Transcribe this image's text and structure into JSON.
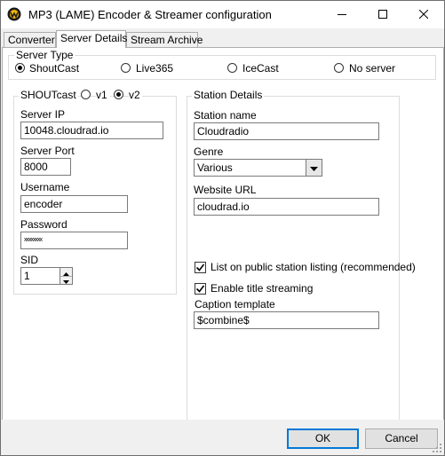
{
  "window": {
    "title": "MP3 (LAME) Encoder & Streamer configuration",
    "app_icon": "winamp-icon",
    "controls": [
      "minimize-icon",
      "maximize-icon",
      "close-icon"
    ]
  },
  "tabs": [
    {
      "label": "Converter",
      "active": false
    },
    {
      "label": "Server Details",
      "active": true
    },
    {
      "label": "Stream Archive",
      "active": false
    }
  ],
  "server_type": {
    "label": "Server Type",
    "options": [
      {
        "label": "ShoutCast",
        "selected": true
      },
      {
        "label": "Live365",
        "selected": false
      },
      {
        "label": "IceCast",
        "selected": false
      },
      {
        "label": "No server",
        "selected": false
      }
    ]
  },
  "shoutcast": {
    "label": "SHOUTcast",
    "version_options": [
      {
        "label": "v1",
        "selected": false
      },
      {
        "label": "v2",
        "selected": true
      }
    ],
    "server_ip_label": "Server IP",
    "server_ip_value": "10048.cloudrad.io",
    "server_port_label": "Server Port",
    "server_port_value": "8000",
    "username_label": "Username",
    "username_value": "encoder",
    "password_label": "Password",
    "password_value": "xxxxxxxx",
    "sid_label": "SID",
    "sid_value": "1"
  },
  "station": {
    "label": "Station Details",
    "name_label": "Station name",
    "name_value": "Cloudradio",
    "genre_label": "Genre",
    "genre_value": "Various",
    "website_label": "Website URL",
    "website_value": "cloudrad.io",
    "list_public_label": "List on public station listing (recommended)",
    "list_public_checked": true,
    "title_streaming_label": "Enable title streaming",
    "title_streaming_checked": true,
    "caption_label": "Caption template",
    "caption_value": "$combine$"
  },
  "footer": {
    "ok_label": "OK",
    "cancel_label": "Cancel"
  }
}
